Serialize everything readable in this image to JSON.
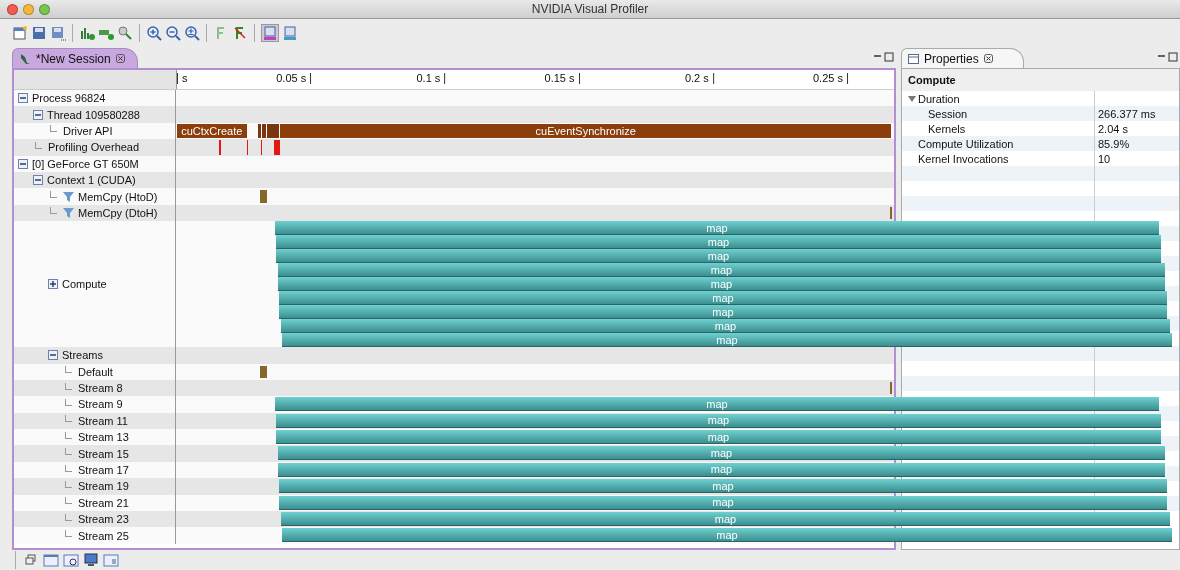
{
  "window": {
    "title": "NVIDIA Visual Profiler"
  },
  "editor_tab": {
    "label": "*New Session",
    "selected": true
  },
  "ruler": {
    "ticks": [
      "s",
      "0.05 s",
      "0.1 s",
      "0.15 s",
      "0.2 s",
      "0.25 s"
    ]
  },
  "tree": [
    {
      "label": "Process 96824",
      "expanded": true,
      "children": [
        {
          "label": "Thread 109580288",
          "expanded": true,
          "children": [
            {
              "label": "Driver API",
              "kind": "api",
              "bars": [
                "cuCtxCreate",
                "cuEventSynchronize"
              ]
            }
          ]
        },
        {
          "label": "Profiling Overhead",
          "kind": "overhead"
        }
      ]
    },
    {
      "label": "[0] GeForce GT 650M",
      "expanded": true,
      "children": [
        {
          "label": "Context 1 (CUDA)",
          "expanded": true,
          "children": [
            {
              "label": "MemCpy (HtoD)",
              "kind": "memcpy_start",
              "filter": true
            },
            {
              "label": "MemCpy (DtoH)",
              "kind": "memcpy_end",
              "filter": true
            },
            {
              "label": "Compute",
              "expanded": false,
              "kind": "kernels",
              "bars": [
                "map",
                "map",
                "map",
                "map",
                "map",
                "map",
                "map",
                "map",
                "map"
              ]
            },
            {
              "label": "Streams",
              "expanded": true,
              "children": [
                {
                  "label": "Default",
                  "kind": "memcpy_start"
                },
                {
                  "label": "Stream 8",
                  "kind": "memcpy_end"
                },
                {
                  "label": "Stream 9",
                  "kind": "kernels",
                  "bars": [
                    "map"
                  ]
                },
                {
                  "label": "Stream 11",
                  "kind": "kernels",
                  "bars": [
                    "map"
                  ]
                },
                {
                  "label": "Stream 13",
                  "kind": "kernels",
                  "bars": [
                    "map"
                  ]
                },
                {
                  "label": "Stream 15",
                  "kind": "kernels",
                  "bars": [
                    "map"
                  ]
                },
                {
                  "label": "Stream 17",
                  "kind": "kernels",
                  "bars": [
                    "map"
                  ]
                },
                {
                  "label": "Stream 19",
                  "kind": "kernels",
                  "bars": [
                    "map"
                  ]
                },
                {
                  "label": "Stream 21",
                  "kind": "kernels",
                  "bars": [
                    "map"
                  ]
                },
                {
                  "label": "Stream 23",
                  "kind": "kernels",
                  "bars": [
                    "map"
                  ]
                },
                {
                  "label": "Stream 25",
                  "kind": "kernels",
                  "bars": [
                    "map"
                  ]
                }
              ]
            }
          ]
        }
      ]
    }
  ],
  "properties": {
    "tab": {
      "label": "Properties",
      "selected": true
    },
    "heading": "Compute",
    "rows": [
      {
        "name": "Duration",
        "expanded": true,
        "children": [
          {
            "name": "Session",
            "value": "266.377 ms"
          },
          {
            "name": "Kernels",
            "value": "2.04 s"
          }
        ]
      },
      {
        "name": "Compute Utilization",
        "value": "85.9%"
      },
      {
        "name": "Kernel Invocations",
        "value": "10"
      }
    ]
  }
}
